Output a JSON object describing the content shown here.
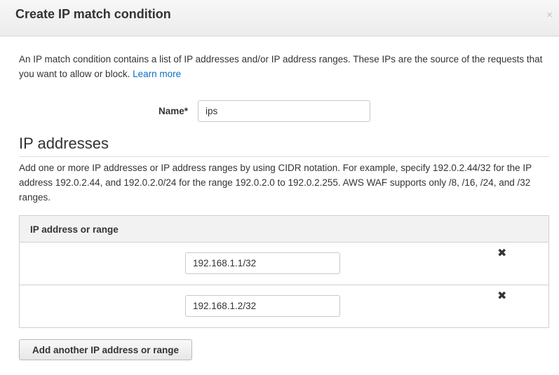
{
  "modal": {
    "title": "Create IP match condition",
    "close_glyph": "×"
  },
  "intro": {
    "text": "An IP match condition contains a list of IP addresses and/or IP address ranges. These IPs are the source of the requests that you want to allow or block.",
    "link_label": "Learn more"
  },
  "name_field": {
    "label": "Name*",
    "value": "ips"
  },
  "ip_section": {
    "title": "IP addresses",
    "description": "Add one or more IP addresses or IP address ranges by using CIDR notation. For example, specify 192.0.2.44/32 for the IP address 192.0.2.44, and 192.0.2.0/24 for the range 192.0.2.0 to 192.0.2.255. AWS WAF supports only /8, /16, /24, and /32 ranges.",
    "table_header": "IP address or range",
    "entries": [
      {
        "value": "192.168.1.1/32",
        "remove_glyph": "✖"
      },
      {
        "value": "192.168.1.2/32",
        "remove_glyph": "✖"
      }
    ],
    "add_button_label": "Add another IP address or range"
  }
}
